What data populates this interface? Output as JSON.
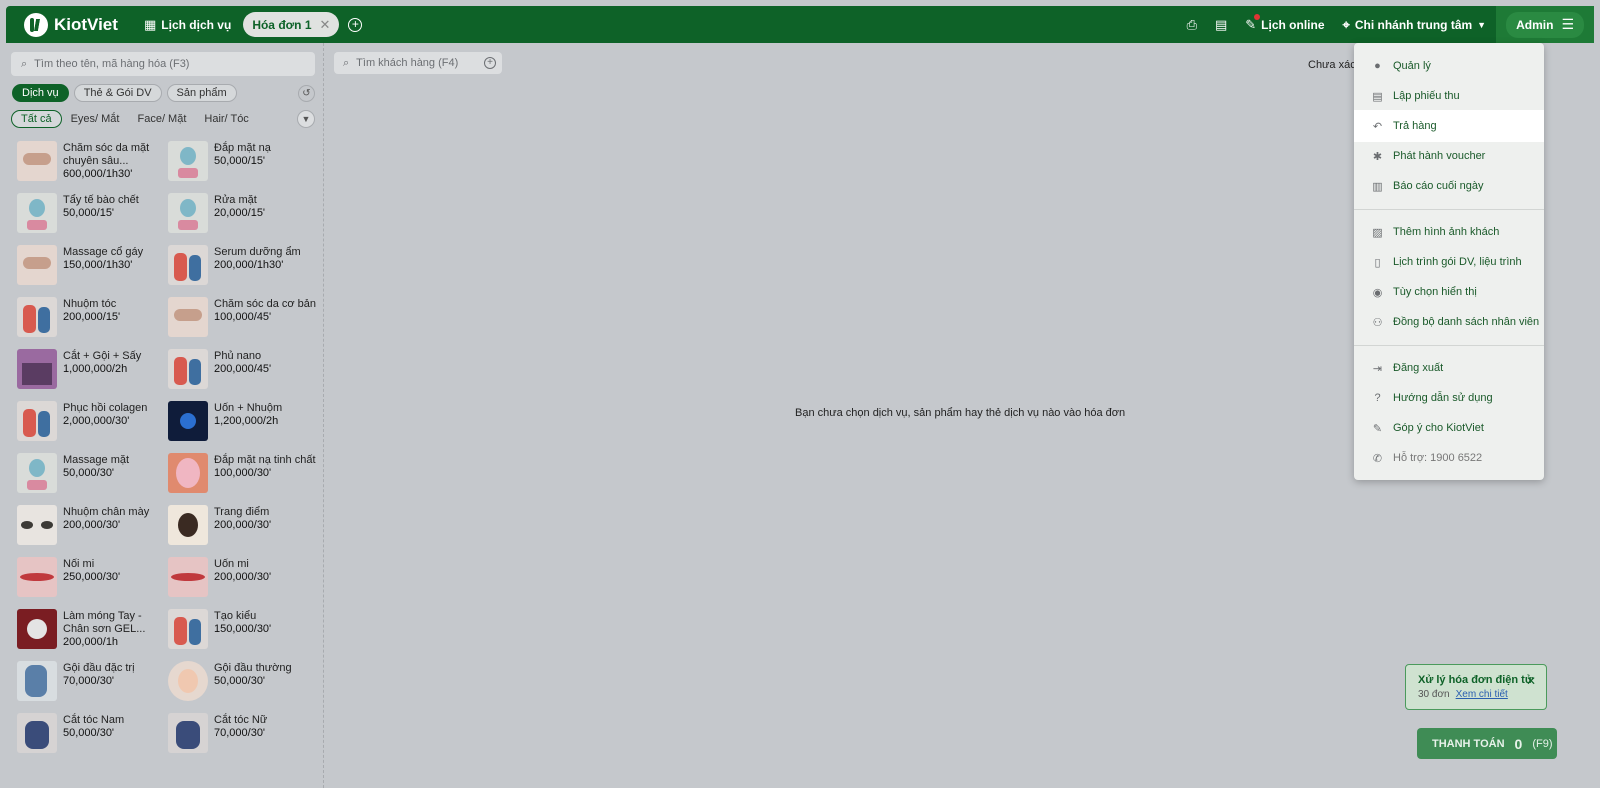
{
  "topbar": {
    "logo_text": "KiotViet",
    "schedule_tab": "Lịch dịch vụ",
    "invoice_tab": "Hóa đơn 1",
    "online_label": "Lịch online",
    "branch_label": "Chi nhánh trung tâm",
    "admin_label": "Admin"
  },
  "left": {
    "search_placeholder": "Tìm theo tên, mã hàng hóa (F3)",
    "categories": [
      "Dịch vụ",
      "Thẻ & Gói DV",
      "Sản phẩm"
    ],
    "subcategories": [
      "Tất cả",
      "Eyes/ Mắt",
      "Face/ Mặt",
      "Hair/ Tóc"
    ],
    "products": [
      {
        "name": "Chăm sóc da mặt chuyên sâu...",
        "price": "600,000/1h30'",
        "icon": "spa"
      },
      {
        "name": "Đắp mặt nạ",
        "price": "50,000/15'",
        "icon": "face"
      },
      {
        "name": "Tẩy tế bào chết",
        "price": "50,000/15'",
        "icon": "face"
      },
      {
        "name": "Rửa mặt",
        "price": "20,000/15'",
        "icon": "face"
      },
      {
        "name": "Massage cổ gáy",
        "price": "150,000/1h30'",
        "icon": "spa"
      },
      {
        "name": "Serum dưỡng ẩm",
        "price": "200,000/1h30'",
        "icon": "hair"
      },
      {
        "name": "Nhuộm tóc",
        "price": "200,000/15'",
        "icon": "hair"
      },
      {
        "name": "Chăm sóc da cơ bản",
        "price": "100,000/45'",
        "icon": "spa"
      },
      {
        "name": "Cắt + Gội + Sấy",
        "price": "1,000,000/2h",
        "icon": "shop"
      },
      {
        "name": "Phủ nano",
        "price": "200,000/45'",
        "icon": "hair"
      },
      {
        "name": "Phục hồi colagen",
        "price": "2,000,000/30'",
        "icon": "hair"
      },
      {
        "name": "Uốn + Nhuộm",
        "price": "1,200,000/2h",
        "icon": "blue"
      },
      {
        "name": "Massage mặt",
        "price": "50,000/30'",
        "icon": "face"
      },
      {
        "name": "Đắp mặt nạ tinh chất",
        "price": "100,000/30'",
        "icon": "mask"
      },
      {
        "name": "Nhuộm chân mày",
        "price": "200,000/30'",
        "icon": "brow"
      },
      {
        "name": "Trang điểm",
        "price": "200,000/30'",
        "icon": "makeup"
      },
      {
        "name": "Nối mi",
        "price": "250,000/30'",
        "icon": "lash"
      },
      {
        "name": "Uốn mi",
        "price": "200,000/30'",
        "icon": "lash"
      },
      {
        "name": "Làm móng Tay - Chân sơn GEL...",
        "price": "200,000/1h",
        "icon": "nail"
      },
      {
        "name": "Tạo kiểu",
        "price": "150,000/30'",
        "icon": "hair"
      },
      {
        "name": "Gội đầu đặc trị",
        "price": "70,000/30'",
        "icon": "wash"
      },
      {
        "name": "Gội đầu thường",
        "price": "50,000/30'",
        "icon": "round"
      },
      {
        "name": "Cắt tóc Nam",
        "price": "50,000/30'",
        "icon": "cut"
      },
      {
        "name": "Cắt tóc Nữ",
        "price": "70,000/30'",
        "icon": "cut"
      }
    ]
  },
  "main": {
    "customer_search_placeholder": "Tìm khách hàng (F4)",
    "status_text": "Chưa xác",
    "empty_message": "Bạn chưa chọn dịch vụ, sản phẩm hay thẻ dịch vụ nào vào hóa đơn"
  },
  "menu": {
    "items": [
      {
        "label": "Quản lý",
        "icon": "user-icon"
      },
      {
        "label": "Lập phiếu thu",
        "icon": "receipt-icon"
      },
      {
        "label": "Trả hàng",
        "icon": "return-icon"
      },
      {
        "label": "Phát hành voucher",
        "icon": "voucher-icon"
      },
      {
        "label": "Báo cáo cuối ngày",
        "icon": "report-icon"
      },
      {
        "label": "Thêm hình ảnh khách",
        "icon": "image-icon"
      },
      {
        "label": "Lịch trình gói DV, liệu trình",
        "icon": "clipboard-icon"
      },
      {
        "label": "Tùy chọn hiển thị",
        "icon": "eye-icon"
      },
      {
        "label": "Đồng bộ danh sách nhân viên",
        "icon": "users-icon"
      },
      {
        "label": "Đăng xuất",
        "icon": "logout-icon"
      },
      {
        "label": "Hướng dẫn sử dụng",
        "icon": "help-icon"
      },
      {
        "label": "Góp ý cho KiotViet",
        "icon": "feedback-icon"
      },
      {
        "label": "Hỗ trợ: 1900 6522",
        "icon": "phone-icon"
      }
    ]
  },
  "notification": {
    "title": "Xử lý hóa đơn điện tử",
    "count": "30 đơn",
    "link": "Xem chi tiết"
  },
  "payment": {
    "label": "THANH TOÁN",
    "amount": "0",
    "shortcut": "(F9)"
  },
  "colors": {
    "brand": "#0e6228",
    "highlight": "#ffffff"
  }
}
